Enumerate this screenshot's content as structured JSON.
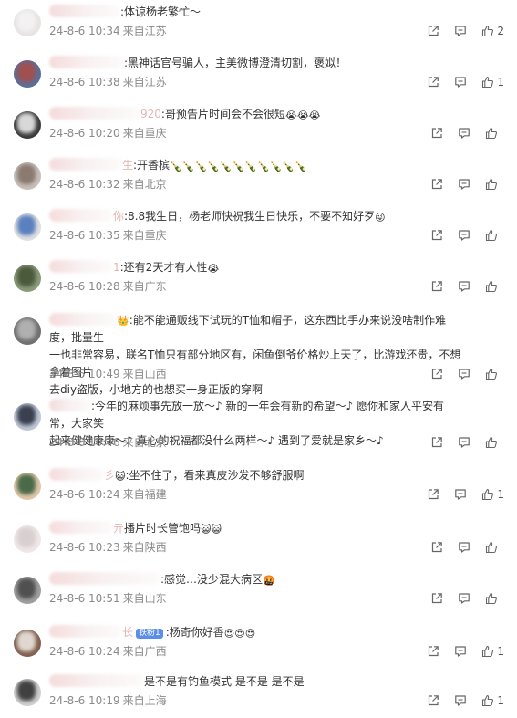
{
  "comments": [
    {
      "text": ":体谅杨老繁忙～",
      "prefix": "",
      "time": "24-8-6 10:34",
      "location": "来自江苏",
      "likes": "2",
      "avatar_colors": [
        "#f2f2f2",
        "#e8e4e4"
      ]
    },
    {
      "text": ":黑神话官号骗人，主美微博澄清切割，褒姒！",
      "prefix": "",
      "time": "24-8-6 10:38",
      "location": "来自江苏",
      "likes": "1",
      "avatar_colors": [
        "#a05050",
        "#5b6e9a"
      ]
    },
    {
      "text": ":哥预告片时间会不会很短",
      "prefix": "",
      "name_tail": "920",
      "time": "24-8-6 10:20",
      "location": "来自重庆",
      "likes": "",
      "emoji": [
        "😭",
        "😭",
        "😭"
      ],
      "avatar_colors": [
        "#d8d8d8",
        "#3a3a3a"
      ]
    },
    {
      "text": ":开香槟",
      "prefix": "",
      "name_tail": "生",
      "time": "24-8-6 10:32",
      "location": "来自北京",
      "likes": "",
      "emoji": [
        "🍾",
        "🍾",
        "🍾",
        "🍾",
        "🍾",
        "🍾",
        "🍾",
        "🍾",
        "🍾",
        "🍾",
        "🍾"
      ],
      "avatar_colors": [
        "#8a7a70",
        "#c8c0b8"
      ]
    },
    {
      "text": ":8.8我生日，杨老师快祝我生日快乐，不要不知好歹",
      "prefix": "",
      "name_tail": "你",
      "time": "24-8-6 10:35",
      "location": "来自重庆",
      "likes": "",
      "emoji": [
        "😜"
      ],
      "avatar_colors": [
        "#5a80c0",
        "#e0e0e0"
      ]
    },
    {
      "text": ":还有2天才有人性",
      "prefix": "",
      "name_tail": "1",
      "time": "24-8-6 10:28",
      "location": "来自广东",
      "likes": "",
      "emoji": [
        "😭"
      ],
      "avatar_colors": [
        "#4a5a3a",
        "#8a9a7a"
      ]
    },
    {
      "text": ":能不能通贩线下试玩的T恤和帽子，这东西比手办来说没啥制作难度，批量生产也非常容易，联名T恤只有部分地区有，闲鱼倒爷价格炒上天了，比游戏还贵，不想拿着图片去diy盗版，小地方的也想买一身正版的穿啊",
      "prefix": "",
      "line1": ":能不能通贩线下试玩的T恤和帽子，这东西比手办来说没啥制作难度，批量生",
      "line2": "一也非常容易，联名T恤只有部分地区有，闲鱼倒爷价格炒上天了，比游戏还贵，不想拿着图片",
      "line3": "去diy盗版，小地方的也想买一身正版的穿啊",
      "time": "24-8-6 10:49",
      "location": "来自山西",
      "likes": "",
      "avatar_colors": [
        "#b0b0b0",
        "#707070"
      ]
    },
    {
      "line1": ":今年的麻烦事先放一放～♪ 新的一年会有新的希望～♪ 愿你和家人平安有常，大家笑",
      "line2": "起来健健康康～♪ 真心的祝福都没什么两样～♪ 遇到了爱就是家乡～♪",
      "time": "24-8-6 10:46",
      "location": "来自北京",
      "likes": "",
      "avatar_colors": [
        "#3a4050",
        "#c0c8d8"
      ]
    },
    {
      "text": ":坐不住了，看来真皮沙发不够舒服啊",
      "prefix": "",
      "name_tail": "彡",
      "time": "24-8-6 10:24",
      "location": "来自福建",
      "likes": "1",
      "emoji_pre": [
        "😺"
      ],
      "avatar_colors": [
        "#4a6a4a",
        "#e0c8a8"
      ]
    },
    {
      "text": "播片时长管饱吗",
      "prefix": "",
      "name_tail": "亓",
      "time": "24-8-6 10:23",
      "location": "来自陕西",
      "likes": "",
      "emoji": [
        "😺",
        "😺"
      ],
      "avatar_colors": [
        "#d8d0d0",
        "#f0e8e8"
      ]
    },
    {
      "text": ":感觉…没少混大病区",
      "prefix": "",
      "time": "24-8-6 10:51",
      "location": "来自山东",
      "likes": "",
      "emoji": [
        "🤬"
      ],
      "avatar_colors": [
        "#505050",
        "#a0a0a0"
      ]
    },
    {
      "text": ":杨奇你好香",
      "prefix": "",
      "name_tail": "长",
      "badge": "铁粉1",
      "time": "24-8-6 10:24",
      "location": "来自广西",
      "likes": "1",
      "emoji": [
        "😍",
        "😍",
        "😍"
      ],
      "avatar_colors": [
        "#e0d8d0",
        "#806050"
      ]
    },
    {
      "text": "是不是有钓鱼模式 是不是 是不是",
      "prefix": "",
      "time": "24-8-6 10:19",
      "location": "来自上海",
      "likes": "1",
      "avatar_colors": [
        "#404040",
        "#d0d0d0"
      ]
    }
  ],
  "icons": {
    "forward": "share-icon",
    "comment": "comment-icon",
    "like": "thumbs-up-icon"
  }
}
